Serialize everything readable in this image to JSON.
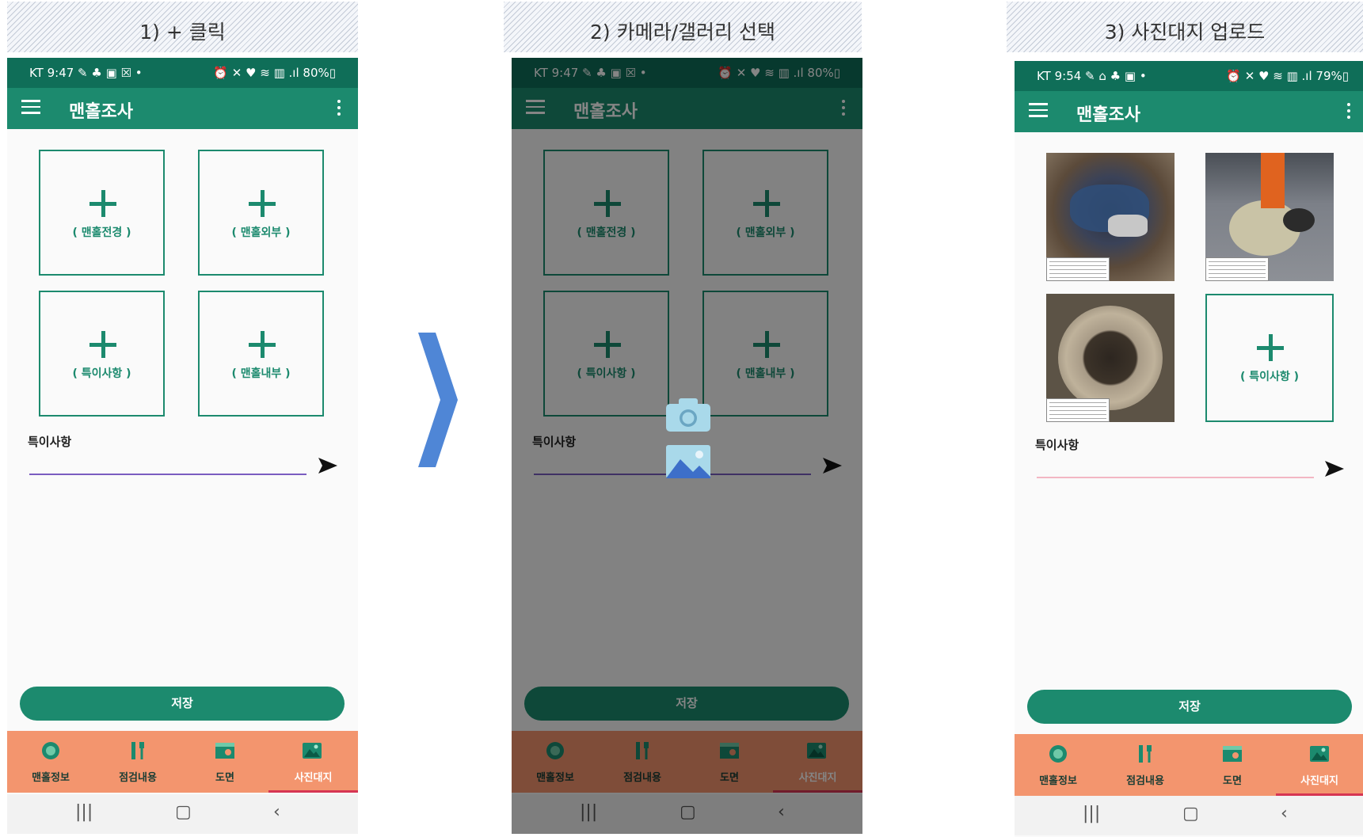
{
  "captions": [
    "1) + 클릭",
    "2) 카메라/갤러리 선택",
    "3) 사진대지 업로드"
  ],
  "phones": [
    {
      "status_left": "KT 9:47 ✎ ♣ ▣ ☒ •",
      "status_right": "⏰ ✕ ♥ ≋ ▥ .ıl 80%▯",
      "app_title": "맨홀조사",
      "tiles": [
        "( 맨홀전경 )",
        "( 맨홀외부 )",
        "( 특이사항 )",
        "( 맨홀내부 )"
      ],
      "memo_label": "특이사항",
      "save_label": "저장",
      "nav": [
        "맨홀정보",
        "점검내용",
        "도면",
        "사진대지"
      ]
    },
    {
      "status_left": "KT 9:47 ✎ ♣ ▣ ☒ •",
      "status_right": "⏰ ✕ ♥ ≋ ▥ .ıl 80%▯",
      "app_title": "맨홀조사",
      "tiles": [
        "( 맨홀전경 )",
        "( 맨홀외부 )",
        "( 특이사항 )",
        "( 맨홀내부 )"
      ],
      "memo_label": "특이사항",
      "save_label": "저장",
      "nav": [
        "맨홀정보",
        "점검내용",
        "도면",
        "사진대지"
      ]
    },
    {
      "status_left": "KT 9:54 ✎ ⌂ ♣ ▣ •",
      "status_right": "⏰ ✕ ♥ ≋ ▥ .ıl 79%▯",
      "app_title": "맨홀조사",
      "tiles": [
        "( 특이사항 )"
      ],
      "memo_label": "특이사항",
      "save_label": "저장",
      "nav": [
        "맨홀정보",
        "점검내용",
        "도면",
        "사진대지"
      ]
    }
  ],
  "colors": {
    "primary": "#1c8a6e",
    "status_bar": "#0f6e58",
    "bottom_nav": "#f3956e",
    "arrow": "#4f86d6",
    "active_indicator": "#d63553"
  }
}
